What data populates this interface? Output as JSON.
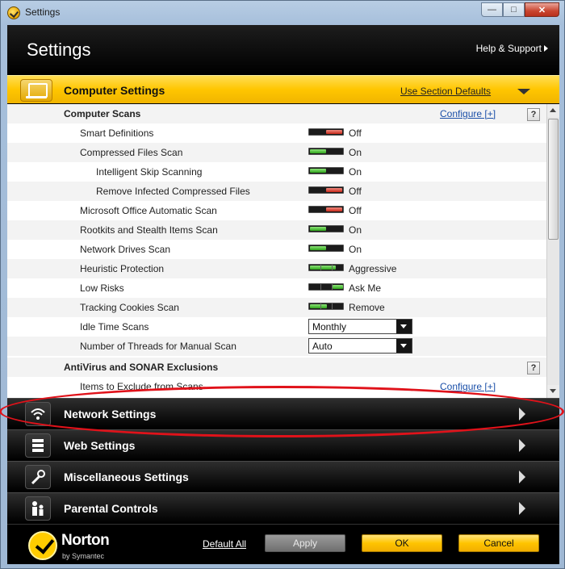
{
  "window": {
    "title": "Settings",
    "buttons": [
      "minimize",
      "maximize",
      "close"
    ]
  },
  "header": {
    "title": "Settings",
    "help_link": "Help & Support"
  },
  "section": {
    "title": "Computer Settings",
    "defaults_link": "Use Section Defaults"
  },
  "groups": [
    {
      "label": "Computer Scans",
      "configure": "Configure [+]",
      "help": "?"
    },
    {
      "label": "AntiVirus and SONAR Exclusions",
      "help": "?"
    }
  ],
  "rows": [
    {
      "label": "Smart Definitions",
      "state": "Off",
      "type": "off"
    },
    {
      "label": "Compressed Files Scan",
      "state": "On",
      "type": "on"
    },
    {
      "label": "Intelligent Skip Scanning",
      "state": "On",
      "type": "on"
    },
    {
      "label": "Remove Infected Compressed Files",
      "state": "Off",
      "type": "off"
    },
    {
      "label": "Microsoft Office Automatic Scan",
      "state": "Off",
      "type": "off"
    },
    {
      "label": "Rootkits and Stealth Items Scan",
      "state": "On",
      "type": "on"
    },
    {
      "label": "Network Drives Scan",
      "state": "On",
      "type": "on"
    },
    {
      "label": "Heuristic Protection",
      "state": "Aggressive",
      "type": "level",
      "level": 0.75
    },
    {
      "label": "Low Risks",
      "state": "Ask Me",
      "type": "level",
      "level": 1.0
    },
    {
      "label": "Tracking Cookies Scan",
      "state": "Remove",
      "type": "level",
      "level": 0.5
    },
    {
      "label": "Idle Time Scans",
      "select_value": "Monthly"
    },
    {
      "label": "Number of Threads for Manual Scan",
      "select_value": "Auto"
    }
  ],
  "exclude_row": {
    "label": "Items to Exclude from Scans",
    "configure": "Configure [+]"
  },
  "nav": [
    {
      "label": "Network Settings",
      "icon": "wifi-icon"
    },
    {
      "label": "Web Settings",
      "icon": "web-stack-icon"
    },
    {
      "label": "Miscellaneous Settings",
      "icon": "wrench-icon"
    },
    {
      "label": "Parental Controls",
      "icon": "family-icon"
    }
  ],
  "footer": {
    "brand": "Norton",
    "brand_sub": "by Symantec",
    "default_all": "Default All",
    "apply": "Apply",
    "ok": "OK",
    "cancel": "Cancel"
  },
  "colors": {
    "accent_yellow": "#ffc600",
    "toggle_on": "#2ea51a",
    "toggle_off": "#c8281a",
    "annotation_red": "#e0121a"
  }
}
